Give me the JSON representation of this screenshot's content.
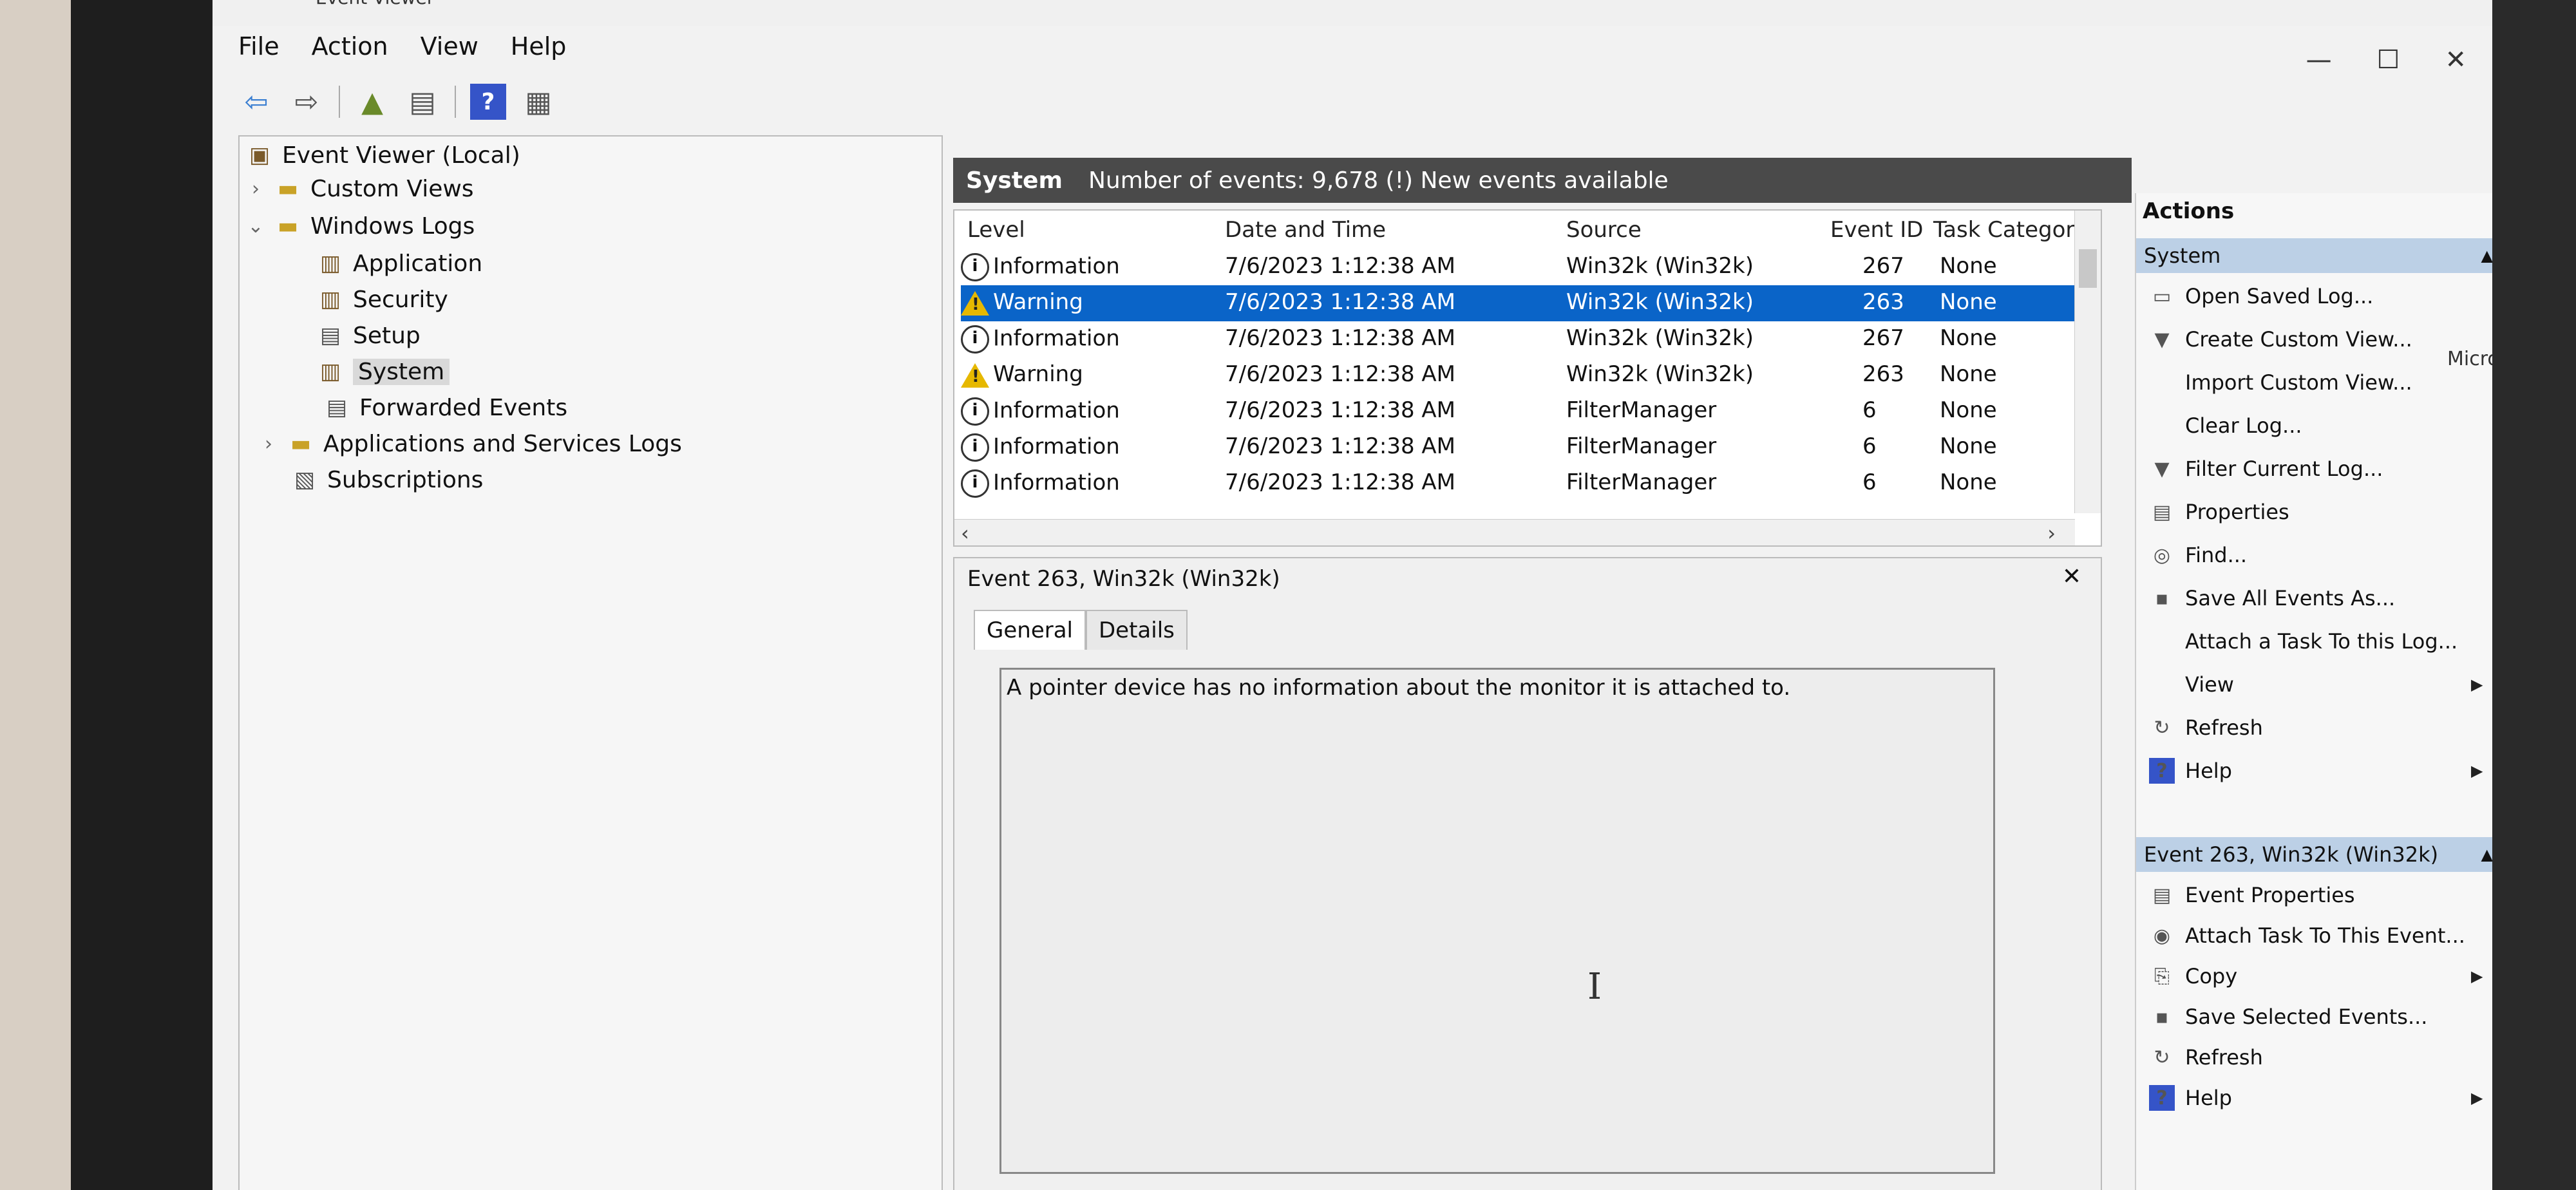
{
  "window": {
    "title": "Event Viewer"
  },
  "menu": [
    "File",
    "Action",
    "View",
    "Help"
  ],
  "window_controls": {
    "minimize": "—",
    "maximize": "☐",
    "close": "✕"
  },
  "tree": {
    "root": "Event Viewer (Local)",
    "custom_views": "Custom Views",
    "windows_logs": "Windows Logs",
    "application": "Application",
    "security": "Security",
    "setup": "Setup",
    "system": "System",
    "forwarded_events": "Forwarded Events",
    "apps_services_logs": "Applications and Services Logs",
    "subscriptions": "Subscriptions"
  },
  "list": {
    "log_name": "System",
    "summary": "Number of events: 9,678 (!) New events available",
    "columns": {
      "level": "Level",
      "date": "Date and Time",
      "source": "Source",
      "event_id": "Event ID",
      "task": "Task Category"
    },
    "rows": [
      {
        "level": "Information",
        "date": "7/6/2023 1:12:38 AM",
        "source": "Win32k (Win32k)",
        "event_id": "267",
        "task": "None"
      },
      {
        "level": "Warning",
        "date": "7/6/2023 1:12:38 AM",
        "source": "Win32k (Win32k)",
        "event_id": "263",
        "task": "None"
      },
      {
        "level": "Information",
        "date": "7/6/2023 1:12:38 AM",
        "source": "Win32k (Win32k)",
        "event_id": "267",
        "task": "None"
      },
      {
        "level": "Warning",
        "date": "7/6/2023 1:12:38 AM",
        "source": "Win32k (Win32k)",
        "event_id": "263",
        "task": "None"
      },
      {
        "level": "Information",
        "date": "7/6/2023 1:12:38 AM",
        "source": "FilterManager",
        "event_id": "6",
        "task": "None"
      },
      {
        "level": "Information",
        "date": "7/6/2023 1:12:38 AM",
        "source": "FilterManager",
        "event_id": "6",
        "task": "None"
      },
      {
        "level": "Information",
        "date": "7/6/2023 1:12:38 AM",
        "source": "FilterManager",
        "event_id": "6",
        "task": "None"
      }
    ]
  },
  "detail": {
    "title": "Event 263, Win32k (Win32k)",
    "tabs": [
      "General",
      "Details"
    ],
    "description": "A pointer device has no information about the monitor it is attached to."
  },
  "actions": {
    "title": "Actions",
    "section1": "System",
    "items1": [
      "Open Saved Log...",
      "Create Custom View...",
      "Import Custom View...",
      "Clear Log...",
      "Filter Current Log...",
      "Properties",
      "Find...",
      "Save All Events As...",
      "Attach a Task To this Log...",
      "View",
      "Refresh",
      "Help"
    ],
    "section2": "Event 263, Win32k (Win32k)",
    "items2": [
      "Event Properties",
      "Attach Task To This Event...",
      "Copy",
      "Save Selected Events...",
      "Refresh",
      "Help"
    ]
  },
  "edge_text": "Micros ff ff ff",
  "colors": {
    "selection": "#0a64c8",
    "header_bar": "#4a4a4a",
    "actions_section": "#bcd0e6"
  }
}
